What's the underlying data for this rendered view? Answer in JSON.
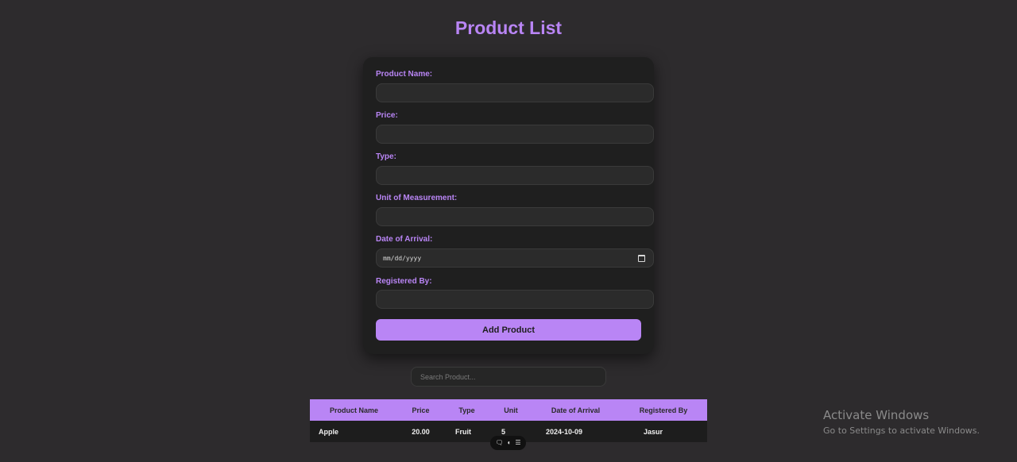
{
  "page": {
    "title": "Product List"
  },
  "form": {
    "fields": [
      {
        "label": "Product Name:",
        "value": ""
      },
      {
        "label": "Price:",
        "value": ""
      },
      {
        "label": "Type:",
        "value": ""
      },
      {
        "label": "Unit of Measurement:",
        "value": ""
      },
      {
        "label": "Date of Arrival:",
        "value": "mm/dd/yyyy"
      },
      {
        "label": "Registered By:",
        "value": ""
      }
    ],
    "submit_label": "Add Product"
  },
  "search": {
    "placeholder": "Search Product..."
  },
  "table": {
    "columns": [
      "Product Name",
      "Price",
      "Type",
      "Unit",
      "Date of Arrival",
      "Registered By"
    ],
    "rows": [
      [
        "Apple",
        "20.00",
        "Fruit",
        "5",
        "2024-10-09",
        "Jasur"
      ]
    ]
  },
  "toolbar": {
    "icons": [
      "chat-bubble-icon",
      "contrast-icon",
      "list-icon"
    ]
  },
  "watermark": {
    "title": "Activate Windows",
    "subtitle": "Go to Settings to activate Windows."
  },
  "colors": {
    "accent": "#b985f5",
    "background": "#2d2b2d",
    "card": "#1f1f1f"
  }
}
